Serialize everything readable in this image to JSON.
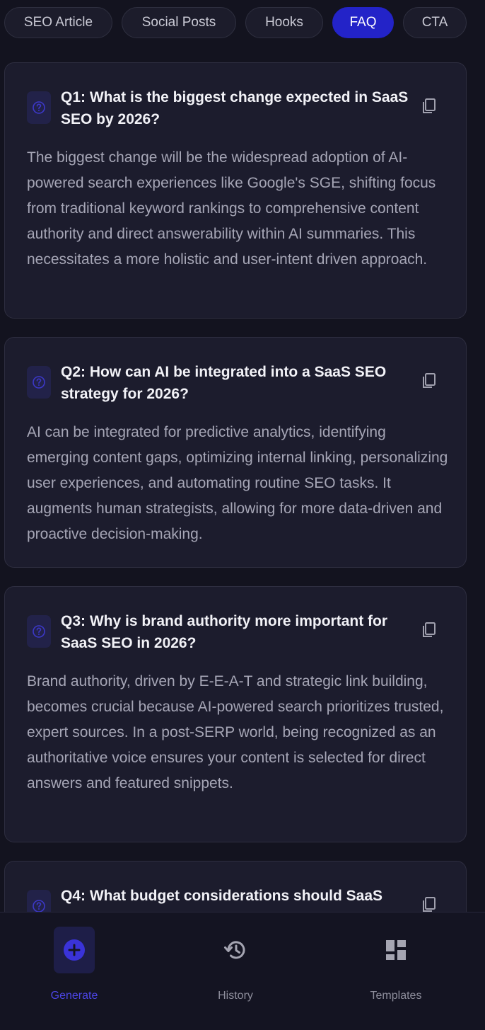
{
  "tabs": [
    {
      "label": "SEO Article"
    },
    {
      "label": "Social Posts"
    },
    {
      "label": "Hooks"
    },
    {
      "label": "FAQ"
    },
    {
      "label": "CTA"
    }
  ],
  "active_tab": "FAQ",
  "faq": [
    {
      "question": "Q1: What is the biggest change expected in SaaS SEO by 2026?",
      "answer": "The biggest change will be the widespread adoption of AI-powered search experiences like Google's SGE, shifting focus from traditional keyword rankings to comprehensive content authority and direct answerability within AI summaries. This necessitates a more holistic and user-intent driven approach."
    },
    {
      "question": "Q2: How can AI be integrated into a SaaS SEO strategy for 2026?",
      "answer": "AI can be integrated for predictive analytics, identifying emerging content gaps, optimizing internal linking, personalizing user experiences, and automating routine SEO tasks. It augments human strategists, allowing for more data-driven and proactive decision-making."
    },
    {
      "question": "Q3: Why is brand authority more important for SaaS SEO in 2026?",
      "answer": "Brand authority, driven by E-E-A-T and strategic link building, becomes crucial because AI-powered search prioritizes trusted, expert sources. In a post-SERP world, being recognized as an authoritative voice ensures your content is selected for direct answers and featured snippets."
    },
    {
      "question": "Q4: What budget considerations should SaaS",
      "answer": ""
    }
  ],
  "nav": [
    {
      "label": "Generate",
      "icon": "add-circle-icon"
    },
    {
      "label": "History",
      "icon": "history-icon"
    },
    {
      "label": "Templates",
      "icon": "dashboard-icon"
    }
  ],
  "active_nav": "Generate",
  "colors": {
    "accent": "#2323c8",
    "background": "#13131f",
    "card": "#1c1c2d",
    "nav_active": "#4c45e6"
  }
}
